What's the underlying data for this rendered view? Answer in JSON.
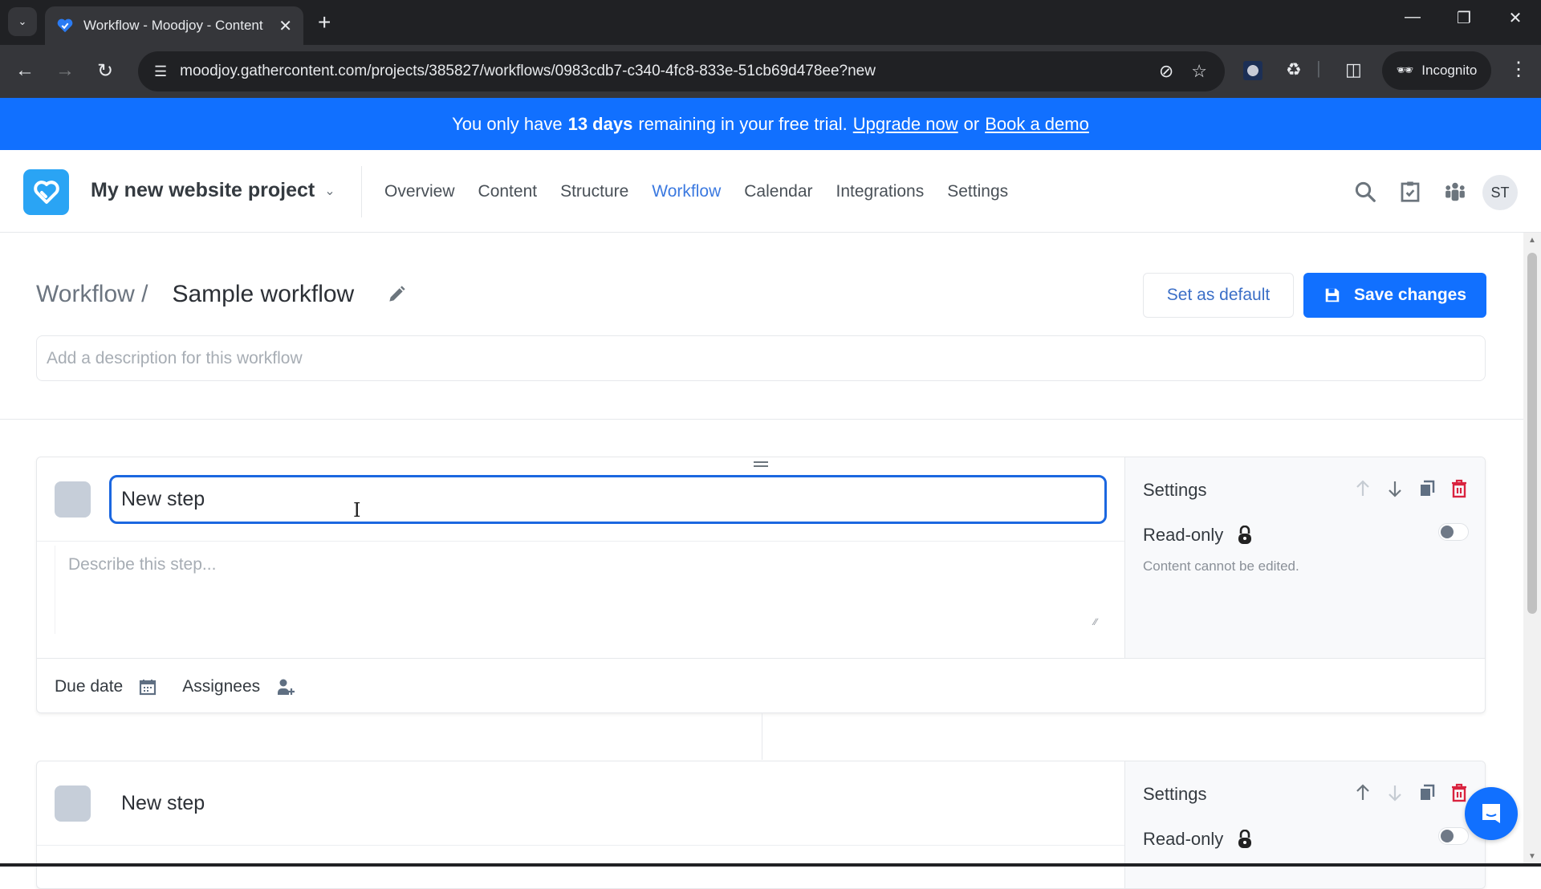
{
  "browser": {
    "tab_title": "Workflow - Moodjoy - Content",
    "url": "moodjoy.gathercontent.com/projects/385827/workflows/0983cdb7-c340-4fc8-833e-51cb69d478ee?new",
    "incognito_label": "Incognito",
    "icons": {
      "tab_search": "chevron-down-icon",
      "close_tab": "close-icon",
      "new_tab": "plus-icon",
      "back": "arrow-left-icon",
      "forward": "arrow-right-icon",
      "reload": "reload-icon",
      "site_info": "tune-icon",
      "tracking": "eye-off-icon",
      "bookmark": "star-icon",
      "extensions": "puzzle-icon",
      "side_panel": "side-panel-icon",
      "menu": "kebab-icon"
    }
  },
  "banner": {
    "prefix": "You only have",
    "highlight": "13 days",
    "suffix": "remaining in your free trial.",
    "upgrade_link": "Upgrade now",
    "or": "or",
    "demo_link": "Book a demo",
    "color": "#1170ff"
  },
  "header": {
    "project_name": "My new website project",
    "nav": [
      {
        "label": "Overview",
        "active": false
      },
      {
        "label": "Content",
        "active": false
      },
      {
        "label": "Structure",
        "active": false
      },
      {
        "label": "Workflow",
        "active": true
      },
      {
        "label": "Calendar",
        "active": false
      },
      {
        "label": "Integrations",
        "active": false
      },
      {
        "label": "Settings",
        "active": false
      }
    ],
    "avatar_initials": "ST",
    "accent_color": "#3b79e0"
  },
  "page": {
    "breadcrumb_parent": "Workflow /",
    "workflow_name": "Sample workflow",
    "set_default_label": "Set as default",
    "save_label": "Save changes",
    "description_placeholder": "Add a description for this workflow",
    "description_value": ""
  },
  "steps": [
    {
      "name": "New step",
      "description_placeholder": "Describe this step...",
      "due_date_label": "Due date",
      "assignees_label": "Assignees",
      "settings_title": "Settings",
      "read_only_label": "Read-only",
      "read_only_desc": "Content cannot be edited.",
      "read_only": false,
      "focused": true
    },
    {
      "name": "New step",
      "settings_title": "Settings",
      "read_only_label": "Read-only",
      "read_only": false,
      "focused": false
    }
  ],
  "colors": {
    "primary": "#1170ff",
    "delete": "#d9233f",
    "step_swatch": "#c6ced9"
  }
}
